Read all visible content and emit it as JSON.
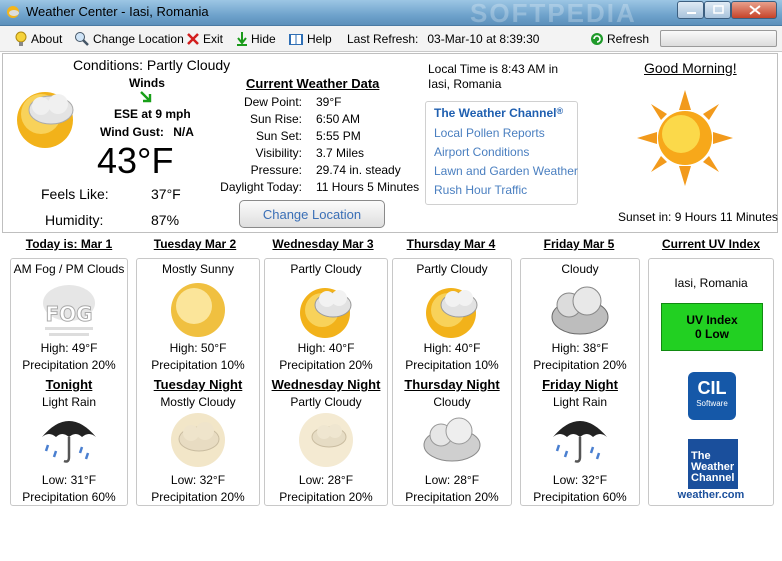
{
  "window": {
    "title": "Weather Center - Iasi, Romania",
    "watermark": "SOFTPEDIA"
  },
  "toolbar": {
    "about": "About",
    "change_location": "Change Location",
    "exit": "Exit",
    "hide": "Hide",
    "help": "Help",
    "last_refresh_label": "Last Refresh:",
    "last_refresh_value": "03-Mar-10 at 8:39:30",
    "refresh": "Refresh"
  },
  "conditions": {
    "label": "Conditions: Partly Cloudy",
    "winds_label": "Winds",
    "wind_value": "ESE at 9 mph",
    "wind_gust_label": "Wind Gust:",
    "wind_gust_value": "N/A",
    "temperature": "43°F",
    "feels_like_label": "Feels Like:",
    "feels_like_value": "37°F",
    "humidity_label": "Humidity:",
    "humidity_value": "87%"
  },
  "current": {
    "title": "Current Weather Data",
    "rows": [
      {
        "label": "Dew Point:",
        "value": "39°F"
      },
      {
        "label": "Sun Rise:",
        "value": "6:50 AM"
      },
      {
        "label": "Sun Set:",
        "value": "5:55 PM"
      },
      {
        "label": "Visibility:",
        "value": "3.7 Miles"
      },
      {
        "label": "Pressure:",
        "value": "29.74 in. steady"
      },
      {
        "label": "Daylight Today:",
        "value": "11 Hours 5 Minutes"
      }
    ],
    "change_location_button": "Change Location"
  },
  "local": {
    "time": "Local Time is 8:43 AM in",
    "place": "Iasi, Romania",
    "twc_title": "The Weather Channel",
    "links": [
      "Local Pollen Reports",
      "Airport Conditions",
      "Lawn and Garden Weather",
      "Rush Hour Traffic"
    ]
  },
  "greeting": {
    "text": "Good Morning!",
    "sunset": "Sunset in: 9 Hours 11 Minutes"
  },
  "forecast": [
    {
      "header": "Today is: Mar 1",
      "day_cond": "AM Fog / PM Clouds",
      "high": "High: 49°F",
      "day_precip": "Precipitation 20%",
      "night_title": "Tonight",
      "night_cond": "Light Rain",
      "low": "Low: 31°F",
      "night_precip": "Precipitation 60%"
    },
    {
      "header": "Tuesday Mar 2",
      "day_cond": "Mostly Sunny",
      "high": "High: 50°F",
      "day_precip": "Precipitation 10%",
      "night_title": "Tuesday Night",
      "night_cond": "Mostly Cloudy",
      "low": "Low: 32°F",
      "night_precip": "Precipitation 20%"
    },
    {
      "header": "Wednesday Mar 3",
      "day_cond": "Partly Cloudy",
      "high": "High: 40°F",
      "day_precip": "Precipitation 20%",
      "night_title": "Wednesday Night",
      "night_cond": "Partly Cloudy",
      "low": "Low: 28°F",
      "night_precip": "Precipitation 20%"
    },
    {
      "header": "Thursday Mar 4",
      "day_cond": "Partly Cloudy",
      "high": "High: 40°F",
      "day_precip": "Precipitation 10%",
      "night_title": "Thursday Night",
      "night_cond": "Cloudy",
      "low": "Low: 28°F",
      "night_precip": "Precipitation 20%"
    },
    {
      "header": "Friday Mar 5",
      "day_cond": "Cloudy",
      "high": "High: 38°F",
      "day_precip": "Precipitation 20%",
      "night_title": "Friday Night",
      "night_cond": "Light Rain",
      "low": "Low: 32°F",
      "night_precip": "Precipitation 60%"
    }
  ],
  "uv": {
    "header": "Current UV Index",
    "place": "Iasi, Romania",
    "index_label": "UV Index",
    "index_value": "0 Low",
    "cil_line1": "CIL",
    "cil_line2": "Software",
    "twc_logo_line1": "The",
    "twc_logo_line2": "Weather",
    "twc_logo_line3": "Channel",
    "twc_logo_url": "weather.com"
  },
  "colors": {
    "uv_low": "#22d022",
    "link": "#4a7fc0",
    "twc_blue": "#1a4f9c"
  }
}
